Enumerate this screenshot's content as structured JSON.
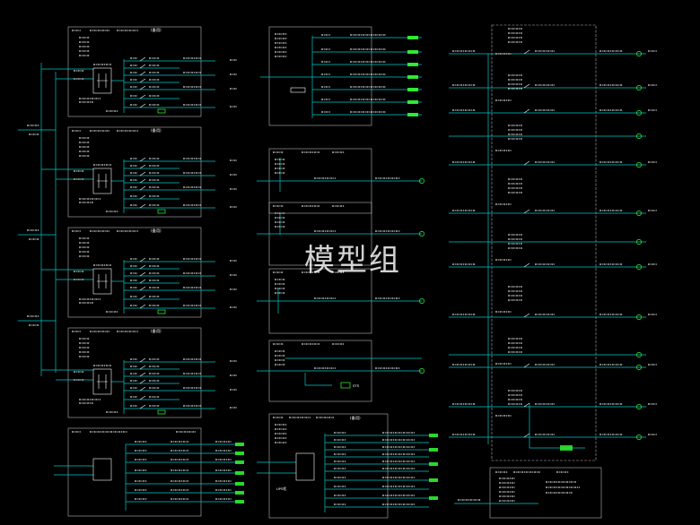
{
  "watermark": "模型组",
  "colors": {
    "background": "#000000",
    "bus": "#00c8c8",
    "frame": "#b4b4b4",
    "text": "#ffffff",
    "feeder": "#33ff33",
    "dim": "#7a7a7a"
  },
  "legible_text": {
    "panel_caption": "(备用)",
    "ups_label": "UPS柜",
    "sts_label": "STS"
  }
}
